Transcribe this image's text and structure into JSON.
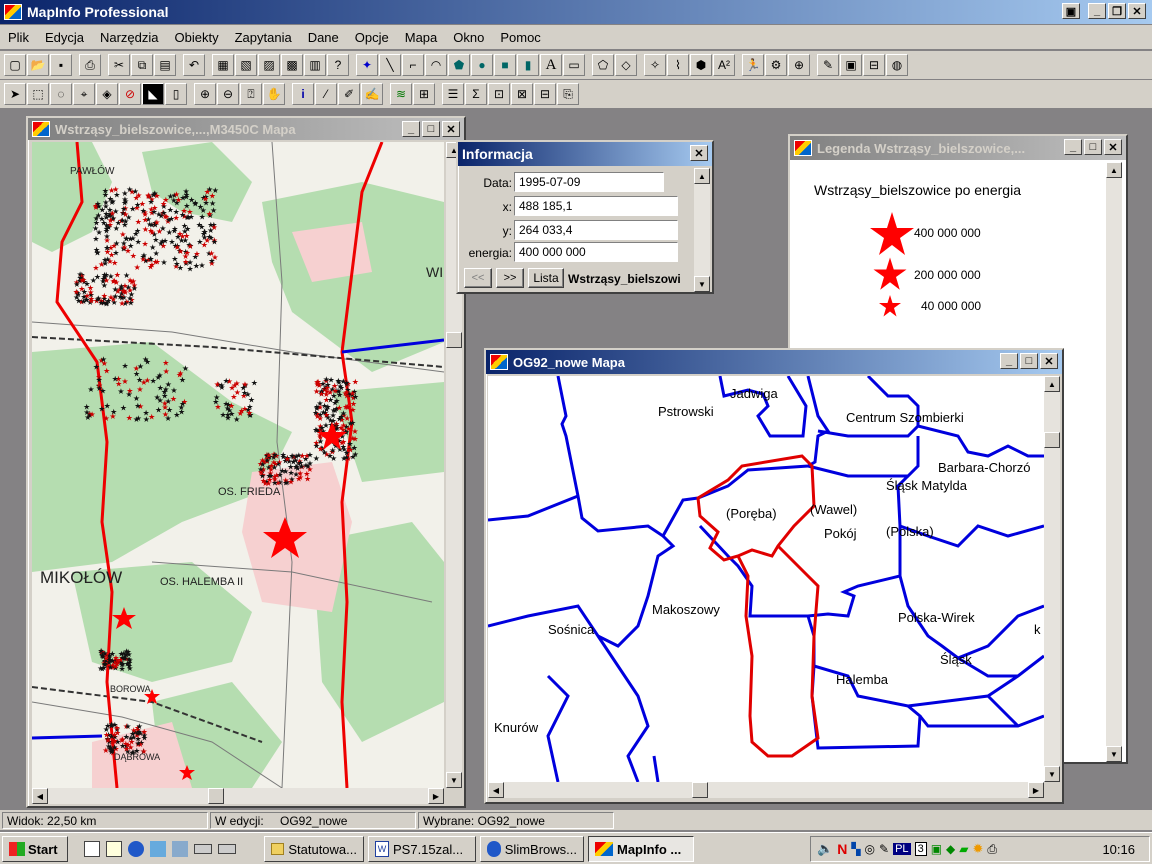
{
  "app": {
    "title": "MapInfo Professional"
  },
  "menu": [
    "Plik",
    "Edycja",
    "Narzędzia",
    "Obiekty",
    "Zapytania",
    "Dane",
    "Opcje",
    "Mapa",
    "Okno",
    "Pomoc"
  ],
  "map_window": {
    "title": "Wstrząsy_bielszowice,...,M3450C Mapa",
    "labels": [
      "MIKOŁÓW",
      "OS. HALEMBA II",
      "OS. FRIEDA",
      "WI",
      "PAWŁÓW",
      "BOROWA",
      "DĄBROWA"
    ]
  },
  "info_window": {
    "title": "Informacja",
    "fields": [
      {
        "label": "Data:",
        "value": "1995-07-09"
      },
      {
        "label": "x:",
        "value": "488 185,1"
      },
      {
        "label": "y:",
        "value": "264 033,4"
      },
      {
        "label": "energia:",
        "value": "400 000 000"
      }
    ],
    "prev_label": "<<",
    "next_label": ">>",
    "list_label": "Lista",
    "table_name": "Wstrząsy_bielszowi"
  },
  "legend_window": {
    "title": "Legenda Wstrząsy_bielszowice,...",
    "heading": "Wstrząsy_bielszowice po energia",
    "items": [
      {
        "value": "400 000 000",
        "icon": "star-large-icon"
      },
      {
        "value": "200 000 000",
        "icon": "star-medium-icon"
      },
      {
        "value": "40 000 000",
        "icon": "star-small-icon"
      }
    ]
  },
  "og_window": {
    "title": "OG92_nowe Mapa",
    "regions": [
      "Jadwiga",
      "Pstrowski",
      "Centrum Szombierki",
      "Barbara-Chorzó",
      "Śląsk Matylda",
      "(Poręba)",
      "(Wawel)",
      "Pokój",
      "(Polska)",
      "Makoszowy",
      "Sośnica",
      "Polska-Wirek",
      "Śląsk",
      "Halemba",
      "Knurów",
      "k"
    ]
  },
  "status_bar": {
    "view": "Widok: 22,50 km",
    "editing_label": "W edycji:",
    "editing_value": "OG92_nowe",
    "selected": "Wybrane: OG92_nowe"
  },
  "taskbar": {
    "start": "Start",
    "tasks": [
      "Statutowa...",
      "PS7.15zal...",
      "SlimBrows...",
      "MapInfo ..."
    ],
    "tray_lang": "PL",
    "clock": "10:16"
  },
  "colors": {
    "title_active": "#0a246a",
    "boundary_blue": "#0000dd",
    "boundary_red": "#e00000",
    "star_red": "#ff0000"
  }
}
